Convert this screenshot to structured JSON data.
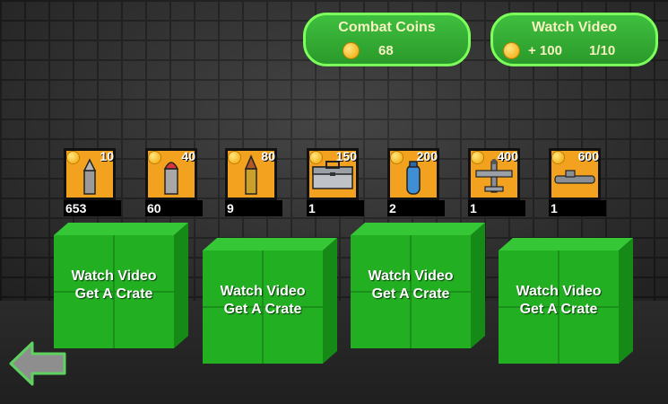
{
  "coins_panel": {
    "title": "Combat Coins",
    "amount": "68"
  },
  "video_panel": {
    "title": "Watch Video",
    "reward": "+ 100",
    "progress": "1/10"
  },
  "items": [
    {
      "name": "bullet-small",
      "price": "10",
      "count": "653"
    },
    {
      "name": "bullet-red",
      "price": "40",
      "count": "60"
    },
    {
      "name": "bullet-gold",
      "price": "80",
      "count": "9"
    },
    {
      "name": "toolbox",
      "price": "150",
      "count": "1"
    },
    {
      "name": "canister",
      "price": "200",
      "count": "2"
    },
    {
      "name": "airplane",
      "price": "400",
      "count": "1"
    },
    {
      "name": "submarine",
      "price": "600",
      "count": "1"
    }
  ],
  "crates": [
    {
      "line1": "Watch Video",
      "line2": "Get A Crate"
    },
    {
      "line1": "Watch Video",
      "line2": "Get A Crate"
    },
    {
      "line1": "Watch Video",
      "line2": "Get A Crate"
    },
    {
      "line1": "Watch Video",
      "line2": "Get A Crate"
    }
  ],
  "icons": {
    "coin": "gold-coin-icon",
    "back": "back-arrow-icon"
  },
  "colors": {
    "panel_green": "#2a9a2a",
    "panel_border": "#7cff5a",
    "item_orange": "#f2a21f",
    "crate_green": "#22b022"
  }
}
